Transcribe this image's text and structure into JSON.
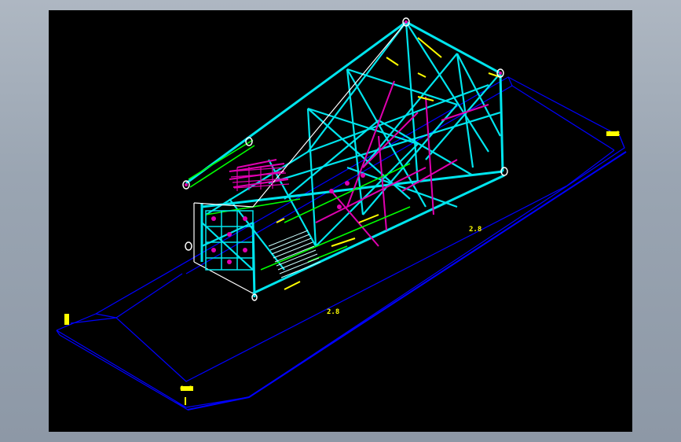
{
  "colors": {
    "background": "#000000",
    "frame": "#9aa5b2",
    "hull": "#0000ff",
    "truss_primary": "#00e5ee",
    "truss_secondary": "#ff00ff",
    "truss_accent": "#ffff00",
    "truss_green": "#00ff00",
    "truss_white": "#ffffff"
  },
  "labels": {
    "dim_right": "2.8",
    "dim_bottom": "2.8",
    "dim_stern": "0.8",
    "dim_left_end": "0",
    "dim_right_end": "0.8"
  }
}
